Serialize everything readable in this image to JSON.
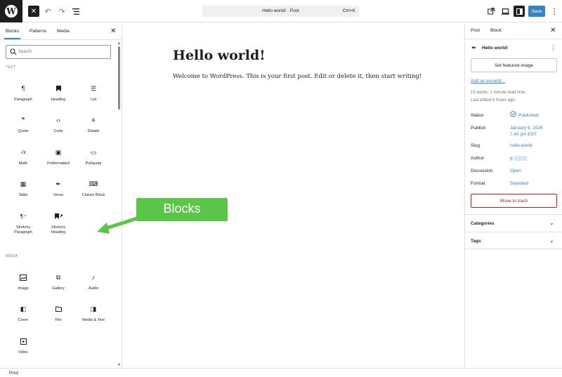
{
  "topbar": {
    "document_title": "Hello world! · Post",
    "shortcut": "Ctrl+K",
    "save_label": "Save",
    "icons": [
      "wordpress-logo-icon",
      "close-icon",
      "undo-icon",
      "redo-icon",
      "list-view-icon",
      "external-link-icon",
      "device-preview-icon",
      "sidebar-toggle-icon",
      "kebab-menu-icon"
    ]
  },
  "inserter": {
    "tabs": [
      "Blocks",
      "Patterns",
      "Media"
    ],
    "active_tab": "Blocks",
    "search_placeholder": "Search",
    "categories": {
      "text": {
        "label": "TEXT",
        "blocks": [
          {
            "label": "Paragraph",
            "icon": "¶"
          },
          {
            "label": "Heading",
            "icon": "🔖"
          },
          {
            "label": "List",
            "icon": "☰"
          },
          {
            "label": "Quote",
            "icon": "❞"
          },
          {
            "label": "Code",
            "icon": "‹›"
          },
          {
            "label": "Details",
            "icon": "≡"
          },
          {
            "label": "Math",
            "icon": "√x"
          },
          {
            "label": "Preformatted",
            "icon": "▣"
          },
          {
            "label": "Pullquote",
            "icon": "▭"
          },
          {
            "label": "Table",
            "icon": "▦"
          },
          {
            "label": "Verse",
            "icon": "✒"
          },
          {
            "label": "Classic Block",
            "icon": "⌨"
          },
          {
            "label": "Stretchy Paragraph",
            "label_line1": "Stretchy",
            "label_line2": "Paragraph",
            "icon": "¶↗"
          },
          {
            "label": "Stretchy Heading",
            "label_line1": "Stretchy",
            "label_line2": "Heading",
            "icon": "🔖↗"
          }
        ]
      },
      "media": {
        "label": "MEDIA",
        "blocks": [
          {
            "label": "Image",
            "icon": "🖼"
          },
          {
            "label": "Gallery",
            "icon": "⧉"
          },
          {
            "label": "Audio",
            "icon": "♪"
          },
          {
            "label": "Cover",
            "icon": "◧"
          },
          {
            "label": "File",
            "icon": "▭"
          },
          {
            "label": "Media & Text",
            "icon": "◨"
          },
          {
            "label": "Video",
            "icon": "▶"
          }
        ]
      }
    }
  },
  "callout": {
    "label": "Blocks",
    "color": "#5ac549"
  },
  "editor": {
    "post_title": "Hello world!",
    "post_body": "Welcome to WordPress. This is your first post. Edit or delete it, then start writing!"
  },
  "settings": {
    "tabs": [
      "Post",
      "Block"
    ],
    "active_tab": "Post",
    "post_title": "Hello world!",
    "featured_image_label": "Set featured image",
    "excerpt_link": "Add an excerpt...",
    "stats_line1": "15 words, 1 minute read time.",
    "stats_line2": "Last edited 6 hours ago.",
    "rows": {
      "status": {
        "label": "Status",
        "value": "Published"
      },
      "publish": {
        "label": "Publish",
        "value_line1": "January 9, 2026",
        "value_line2": "7:40 pm EST"
      },
      "slug": {
        "label": "Slug",
        "value": "hello-world"
      },
      "author": {
        "label": "Author",
        "value": "g"
      },
      "discussion": {
        "label": "Discussion",
        "value": "Open"
      },
      "format": {
        "label": "Format",
        "value": "Standard"
      }
    },
    "trash_label": "Move to trash",
    "panels": [
      "Categories",
      "Tags"
    ]
  },
  "footer": {
    "breadcrumb": "Post"
  },
  "colors": {
    "accent": "#3582c4",
    "danger": "#cc1818",
    "callout": "#5ac549",
    "topbar_dark": "#1e1e1e"
  }
}
